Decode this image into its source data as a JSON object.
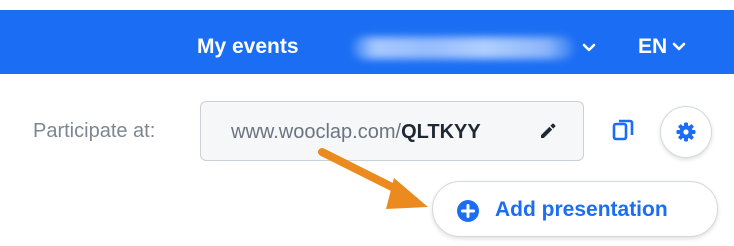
{
  "header": {
    "my_events_label": "My events",
    "user_name": "",
    "language": "EN",
    "background_color": "#1b6ef3"
  },
  "participate": {
    "label": "Participate at:",
    "url_base": "www.wooclap.com/",
    "event_code": "QLTKYY",
    "edit_icon": "pencil-icon",
    "copy_icon": "copy-icon",
    "settings_icon": "gear-icon"
  },
  "add_presentation": {
    "label": "Add presentation",
    "icon": "plus-circle-icon",
    "accent_color": "#1b6ef3"
  },
  "annotation": {
    "icon": "arrow-icon",
    "color": "#ea8a1f"
  }
}
